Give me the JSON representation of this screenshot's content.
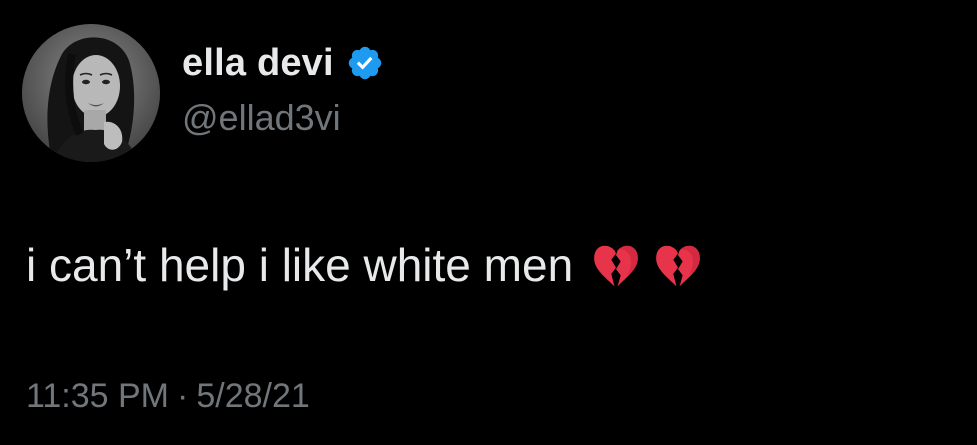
{
  "user": {
    "display_name": "ella devi",
    "handle": "@ellad3vi",
    "verified": true,
    "verified_icon": "verified-badge-icon",
    "verified_color": "#1d9bf0",
    "avatar_icon": "profile-photo"
  },
  "tweet": {
    "text": "i can’t help i like white men",
    "emojis": [
      "broken-heart-icon",
      "broken-heart-icon"
    ]
  },
  "meta": {
    "time": "11:35 PM",
    "separator": "·",
    "date": "5/28/21"
  },
  "colors": {
    "background": "#000000",
    "primary_text": "#e7e9ea",
    "secondary_text": "#71767b",
    "heart": "#e8344a"
  }
}
